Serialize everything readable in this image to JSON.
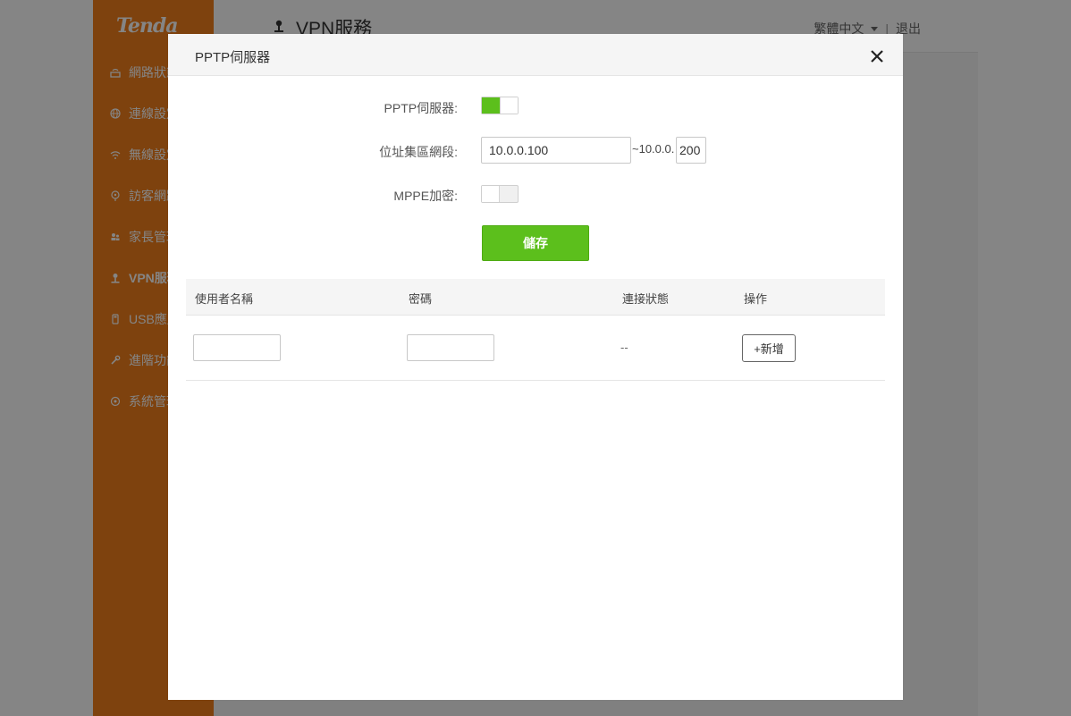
{
  "app": {
    "logo_text": "Tenda",
    "page_title": "VPN服務",
    "language": "繁體中文",
    "separator": "|",
    "logout": "退出",
    "brand_color": "#f17f1c",
    "accent_color": "#5cbf1c"
  },
  "sidebar": {
    "items": [
      {
        "label": "網路狀態",
        "icon": "router-icon"
      },
      {
        "label": "連線設定",
        "icon": "globe-icon"
      },
      {
        "label": "無線設定",
        "icon": "wifi-icon"
      },
      {
        "label": "訪客網路",
        "icon": "guest-icon"
      },
      {
        "label": "家長管理",
        "icon": "parental-icon"
      },
      {
        "label": "VPN服務",
        "icon": "vpn-icon",
        "active": true
      },
      {
        "label": "USB應用",
        "icon": "usb-icon"
      },
      {
        "label": "進階功能",
        "icon": "wrench-icon"
      },
      {
        "label": "系統管理",
        "icon": "gear-icon"
      }
    ]
  },
  "modal": {
    "title": "PPTP伺服器",
    "pptp_label": "PPTP伺服器:",
    "pptp_enabled": true,
    "address_pool_label": "位址集區網段:",
    "address_start": "10.0.0.100",
    "address_end_prefix": "~10.0.0.",
    "address_end": "200",
    "mppe_label": "MPPE加密:",
    "mppe_enabled": false,
    "save_label": "儲存",
    "table": {
      "columns": [
        "使用者名稱",
        "密碼",
        "連接狀態",
        "操作"
      ],
      "new_row": {
        "username": "",
        "password": "",
        "status": "--",
        "action": "+新增"
      }
    }
  }
}
